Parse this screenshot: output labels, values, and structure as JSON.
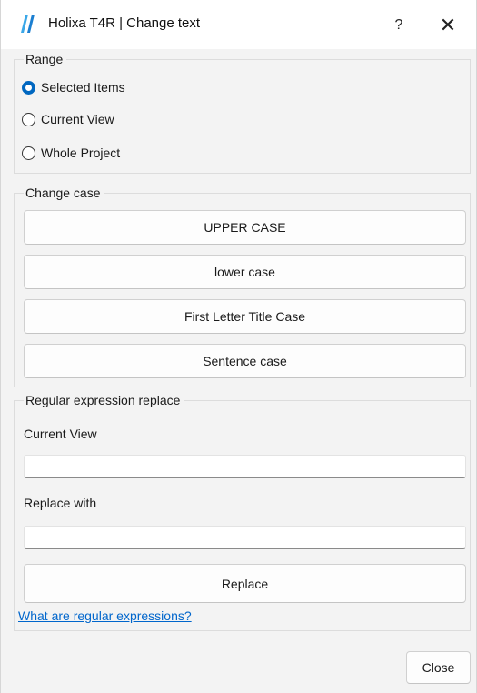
{
  "window": {
    "title": "Holixa T4R | Change text",
    "help_label": "?",
    "close_glyph": "✕",
    "accent_color": "#0067c0"
  },
  "range": {
    "title": "Range",
    "options": [
      {
        "label": "Selected Items",
        "checked": true
      },
      {
        "label": "Current View",
        "checked": false
      },
      {
        "label": "Whole Project",
        "checked": false
      }
    ]
  },
  "change_case": {
    "title": "Change case",
    "buttons": [
      "UPPER CASE",
      "lower case",
      "First Letter Title Case",
      "Sentence case"
    ]
  },
  "regex": {
    "title": "Regular expression replace",
    "find_label": "Current View",
    "find_value": "",
    "replace_label": "Replace with",
    "replace_value": "",
    "replace_button": "Replace",
    "help_link": "What are regular expressions?"
  },
  "footer": {
    "close_button": "Close"
  },
  "icons": {
    "app": "holixa-logo-icon",
    "help": "help-icon",
    "close": "close-icon"
  }
}
